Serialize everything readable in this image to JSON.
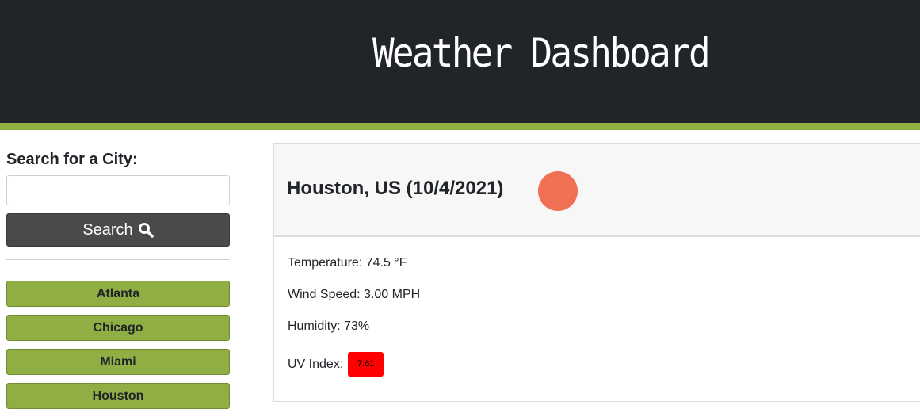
{
  "header": {
    "title": "Weather Dashboard"
  },
  "colors": {
    "header_bg": "#212529",
    "accent": "#8faf44",
    "search_button": "#4a4a4c",
    "uv_high": "#ff0000",
    "icon_sun": "#ef7052"
  },
  "sidebar": {
    "search_label": "Search for a City:",
    "search_value": "",
    "search_button_label": "Search",
    "search_icon": "magnifier-icon",
    "history": [
      "Atlanta",
      "Chicago",
      "Miami",
      "Houston"
    ]
  },
  "current": {
    "title": "Houston, US (10/4/2021)",
    "icon": "weather-icon",
    "temperature": "Temperature: 74.5 °F",
    "wind": "Wind Speed: 3.00 MPH",
    "humidity": "Humidity: 73%",
    "uv_label": "UV Index:",
    "uv_value": "7.61"
  }
}
